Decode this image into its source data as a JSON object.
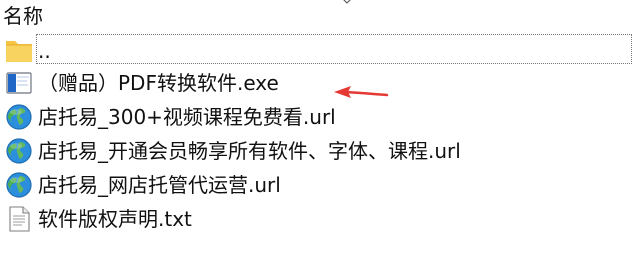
{
  "header": {
    "name_label": "名称"
  },
  "file_list": {
    "parent_label": "..",
    "items": [
      {
        "name": "（赠品）PDF转换软件.exe",
        "icon": "exe-app-icon"
      },
      {
        "name": "店托易_300+视频课程免费看.url",
        "icon": "globe-url-icon"
      },
      {
        "name": "店托易_开通会员畅享所有软件、字体、课程.url",
        "icon": "globe-url-icon"
      },
      {
        "name": "店托易_网店托管代运营.url",
        "icon": "globe-url-icon"
      },
      {
        "name": "软件版权声明.txt",
        "icon": "text-file-icon"
      }
    ]
  },
  "colors": {
    "annotation_arrow": "#e53935",
    "folder": "#f6c442",
    "globe": "#2b8fdd",
    "exe_icon": "#2067c6"
  }
}
